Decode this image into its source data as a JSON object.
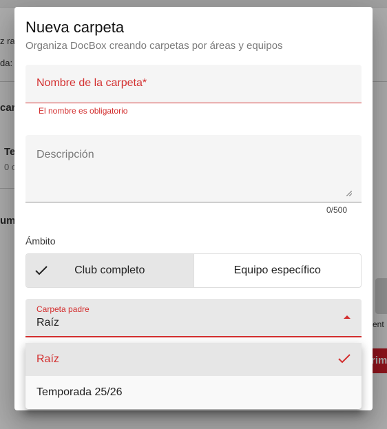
{
  "background": {
    "fragments": [
      "z raí",
      "da:",
      "carp",
      "Te",
      "0 c",
      "um",
      "ent",
      "rim"
    ]
  },
  "dialog": {
    "title": "Nueva carpeta",
    "subtitle": "Organiza DocBox creando carpetas por áreas y equipos",
    "name_field": {
      "placeholder": "Nombre de la carpeta*",
      "error": "El nombre es obligatorio"
    },
    "description_field": {
      "placeholder": "Descripción",
      "counter": "0/500"
    },
    "scope": {
      "label": "Ámbito",
      "options": [
        "Club completo",
        "Equipo específico"
      ],
      "selected": "Club completo"
    },
    "parent_folder": {
      "label": "Carpeta padre",
      "value": "Raíz",
      "options": [
        "Raíz",
        "Temporada 25/26"
      ],
      "selected": "Raíz"
    }
  },
  "colors": {
    "accent": "#d32f2f",
    "field_bg": "#f5f5f5",
    "selected_bg": "#e6e6e6"
  }
}
